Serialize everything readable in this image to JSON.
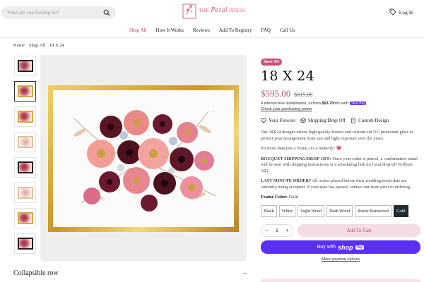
{
  "search": {
    "placeholder": "What are you looking for?"
  },
  "logo": {
    "prefix": "THE ",
    "script": "Petal",
    "suffix": " PRESS"
  },
  "header": {
    "login_label": "Log In"
  },
  "nav": [
    {
      "label": "Shop All",
      "active": true
    },
    {
      "label": "How It Works"
    },
    {
      "label": "Reviews"
    },
    {
      "label": "Add To Registry"
    },
    {
      "label": "FAQ"
    },
    {
      "label": "Call Us"
    }
  ],
  "breadcrumb": [
    "Home",
    "Shop All",
    "18 X 24"
  ],
  "product": {
    "badge": "Save 3%",
    "title": "18 X 24",
    "price": "$595.00",
    "compare_price": "$615.00",
    "installments_prefix": "4 interest-free installments, or from ",
    "installments_amount": "$53.70",
    "installments_suffix": "/mo with ",
    "shoppay_mini": "shop Pay",
    "check_power": "Check your purchasing power",
    "features": [
      "Your Flowers",
      "Shipping/Drop Off",
      "Custom Design"
    ],
    "desc1": "Our 18X24 designs utilize high-quality frames and custom-cut UV protectant glass to protect your arrangement from sun and light exposure over the years.",
    "desc2": "It's more than just a frame, it's a memory!",
    "desc2_heart": "💗",
    "desc3_label": "BOUQUET SHIPPING/DROP-OFF:",
    "desc3": " Once your order is placed, a confirmation email will be sent with shipping instructions or a scheduling link for local drop-off (Gilbert, AZ).",
    "desc4_label": "LAST MINUTE ORDER?",
    "desc4": " All orders placed before their wedding/event date are currently being accepted. If your date has passed, contact our team prior to ordering.",
    "frame_color_label": "Frame Color:",
    "frame_color_value": "Gold",
    "swatches": [
      "Black",
      "White",
      "Light Wood",
      "Dark Wood",
      "Rustic Barnwood",
      "Gold"
    ],
    "selected_swatch": "Gold",
    "quantity": "1",
    "qty_minus": "−",
    "qty_plus": "+",
    "add_to_cart": "Add To Cart",
    "buy_now_prefix": "Buy with",
    "buy_now_brand": "shop",
    "buy_now_pay": "Pay",
    "more_payment": "More payment options"
  },
  "collapsible": {
    "label": "Collapsible row",
    "toggle": "–"
  },
  "colors": {
    "accent": "#cc4f76",
    "shoppay": "#5a31f4",
    "nav_active": "#c2456c"
  }
}
